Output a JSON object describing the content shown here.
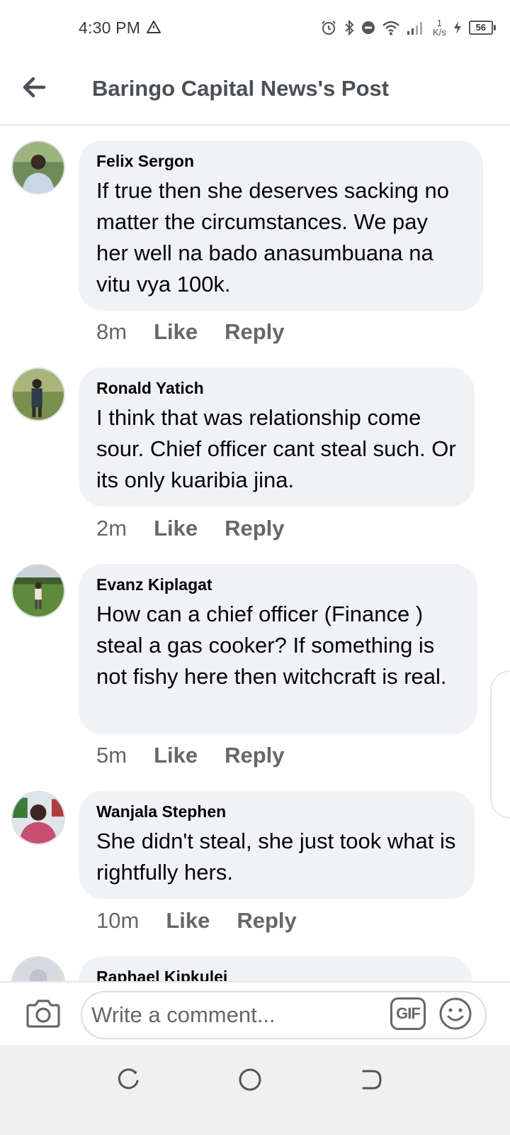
{
  "status_bar": {
    "time": "4:30 PM",
    "net_speed_value": "1",
    "net_speed_unit": "K/s",
    "battery": "56"
  },
  "header": {
    "title": "Baringo Capital News's Post"
  },
  "comments": [
    {
      "author": "Felix Sergon",
      "text": "If true then she deserves sacking no matter the circumstances. We pay her well na bado anasumbuana na vitu vya 100k.",
      "time": "8m",
      "like_label": "Like",
      "reply_label": "Reply"
    },
    {
      "author": "Ronald Yatich",
      "text": "I think that was relationship come sour. Chief officer cant steal such. Or its only kuaribia jina.",
      "time": "2m",
      "like_label": "Like",
      "reply_label": "Reply"
    },
    {
      "author": "Evanz Kiplagat",
      "text": "How can a chief officer (Finance ) steal a gas cooker? If something is not fishy here then witchcraft is real.",
      "time": "5m",
      "like_label": "Like",
      "reply_label": "Reply"
    },
    {
      "author": "Wanjala Stephen",
      "text": "She didn't steal, she just took what is rightfully hers.",
      "time": "10m",
      "like_label": "Like",
      "reply_label": "Reply"
    },
    {
      "author": "Raphael Kipkulei"
    }
  ],
  "composer": {
    "placeholder": "Write a comment...",
    "gif_label": "GIF"
  },
  "icons": {
    "back": "arrow-left-icon",
    "camera": "camera-icon",
    "emoji": "smiley-icon"
  }
}
